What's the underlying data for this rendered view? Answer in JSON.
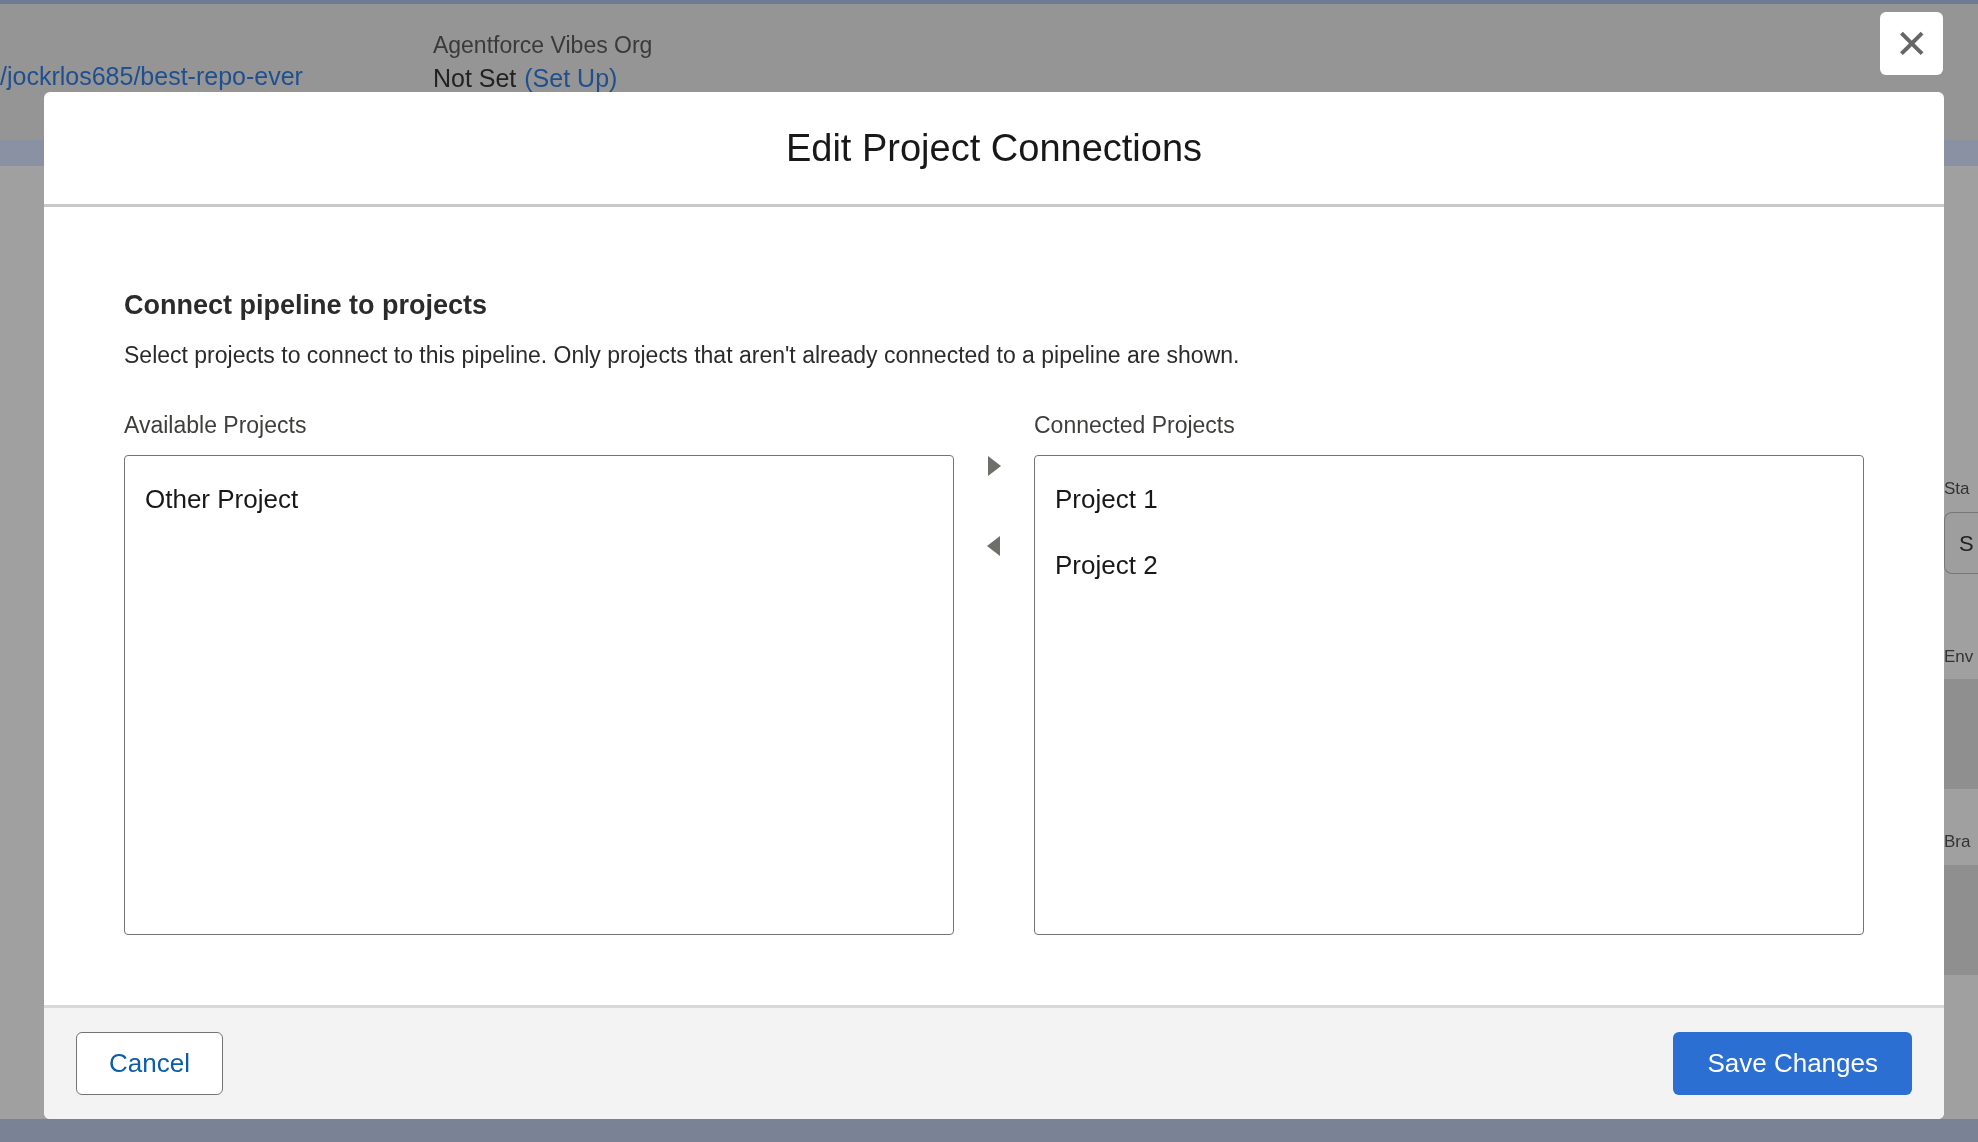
{
  "background": {
    "repo_link": "/jockrlos685/best-repo-ever",
    "org_label": "Agentforce Vibes Org",
    "org_status": "Not Set",
    "org_setup_link": "(Set Up)",
    "side_labels": [
      "Sta",
      "Env",
      "Bra"
    ],
    "side_select_value": "S"
  },
  "close_button": {
    "glyph": "✕"
  },
  "modal": {
    "title": "Edit Project Connections",
    "heading": "Connect pipeline to projects",
    "description": "Select projects to connect to this pipeline. Only projects that aren't already connected to a pipeline are shown.",
    "available": {
      "label": "Available Projects",
      "items": [
        {
          "label": "Other Project",
          "selected": false
        }
      ]
    },
    "connected": {
      "label": "Connected Projects",
      "items": [
        {
          "label": "Project 1",
          "selected": false
        },
        {
          "label": "Project 2",
          "selected": false
        }
      ]
    },
    "buttons": [
      {
        "label": "Cancel",
        "kind": "secondary"
      },
      {
        "label": "Save Changes",
        "kind": "primary"
      }
    ]
  }
}
